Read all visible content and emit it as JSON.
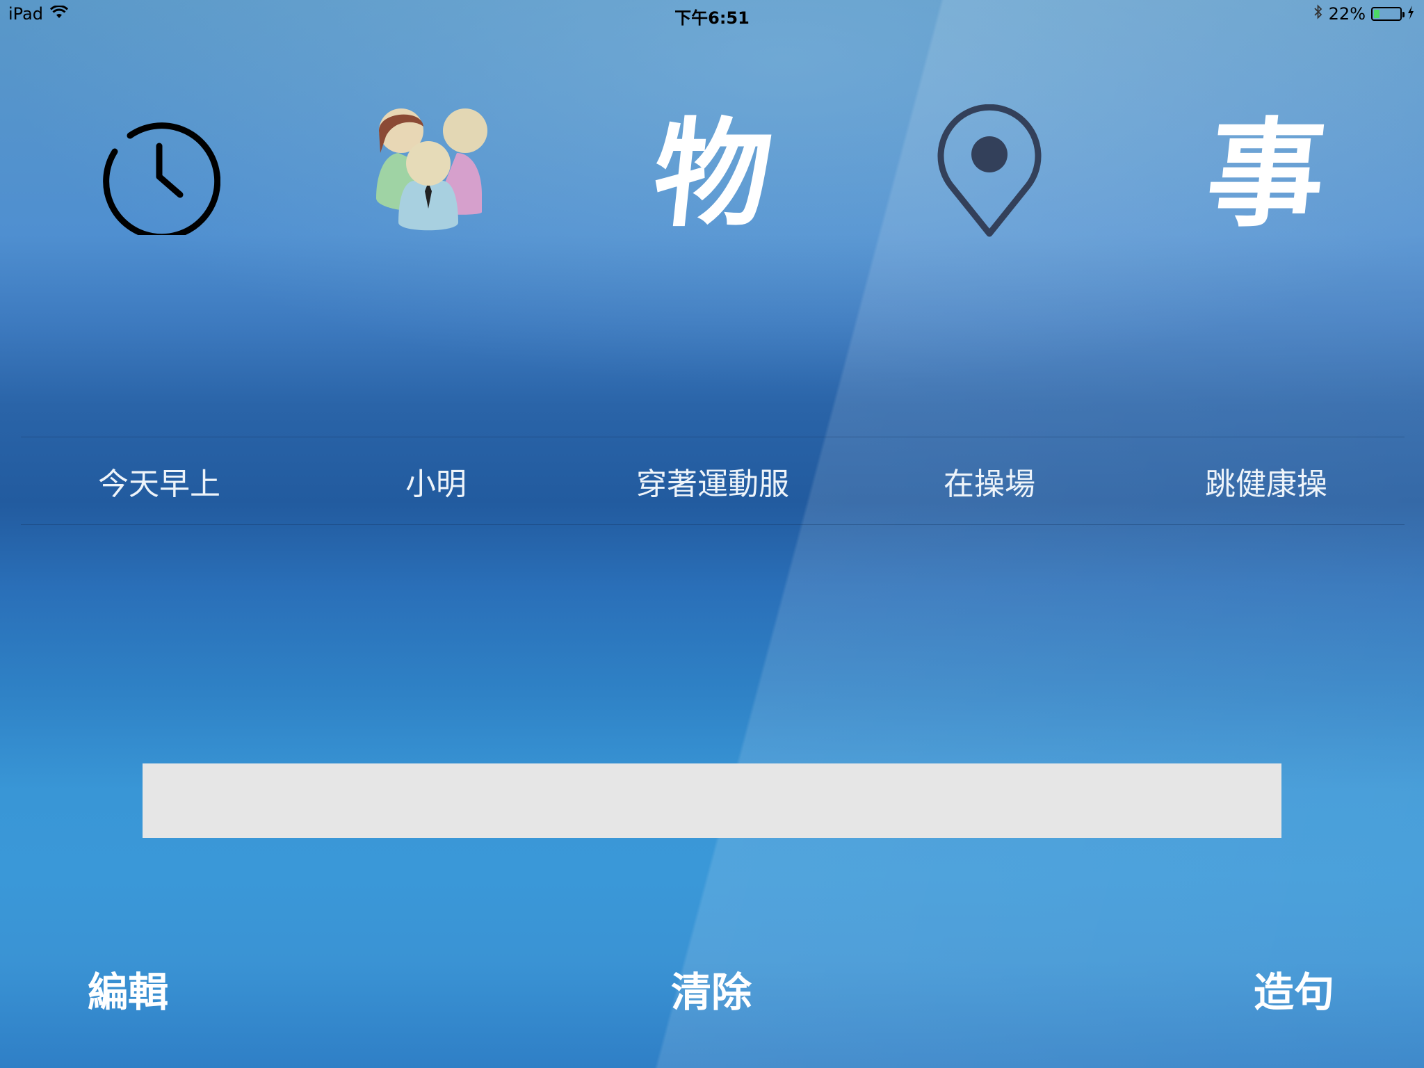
{
  "status_bar": {
    "device": "iPad",
    "time": "下午6:51",
    "battery_percent": "22%",
    "battery_level": 0.22,
    "icons": [
      "wifi-icon",
      "bluetooth-icon",
      "battery-icon",
      "charging-bolt-icon"
    ]
  },
  "categories": [
    {
      "icon": "clock-icon",
      "label": "今天早上"
    },
    {
      "icon": "people-icon",
      "label": "小明"
    },
    {
      "icon": "wu-character-icon",
      "glyph": "物",
      "label": "穿著運動服"
    },
    {
      "icon": "location-pin-icon",
      "label": "在操場"
    },
    {
      "icon": "shi-character-icon",
      "glyph": "事",
      "label": "跳健康操"
    }
  ],
  "output": {
    "value": "",
    "placeholder": ""
  },
  "buttons": {
    "edit": "編輯",
    "clear": "清除",
    "make_sentence": "造句"
  },
  "colors": {
    "output_bg": "#e6e6e6",
    "button_text": "#ffffff",
    "battery_fill": "#4cd964"
  }
}
